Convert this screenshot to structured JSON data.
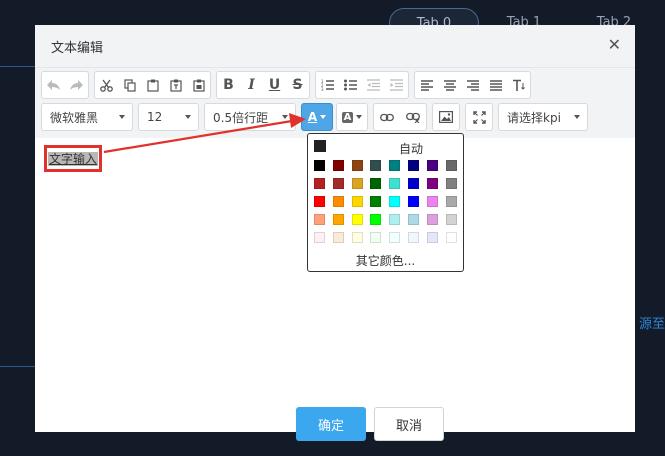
{
  "background": {
    "tabs": [
      "Tab 0",
      "Tab 1",
      "Tab 2"
    ],
    "side_text": "源至"
  },
  "dialog": {
    "title": "文本编辑",
    "close_glyph": "✕"
  },
  "toolbar": {
    "font_family": "微软雅黑",
    "font_size": "12",
    "line_height": "0.5倍行距",
    "kpi_placeholder": "请选择kpi",
    "icons_row1": [
      "undo-icon",
      "redo-icon",
      "cut-icon",
      "copy-icon",
      "paste-icon",
      "paste-text-icon",
      "paste-word-icon",
      "bold-icon",
      "italic-icon",
      "underline-icon",
      "strikethrough-icon",
      "ordered-list-icon",
      "unordered-list-icon",
      "outdent-icon",
      "indent-icon",
      "align-left-icon",
      "align-center-icon",
      "align-right-icon",
      "align-justify-icon",
      "clear-format-icon"
    ],
    "icons_row2": [
      "font-color-icon",
      "background-color-icon",
      "link-icon",
      "unlink-icon",
      "image-icon",
      "fullscreen-icon"
    ],
    "font_color_letter": "A",
    "bg_color_letter": "A"
  },
  "editor": {
    "content": "文字输入"
  },
  "color_picker": {
    "auto_label": "自动",
    "more_label": "其它颜色...",
    "rows": [
      [
        "#000000",
        "#800000",
        "#8b4513",
        "#2f4f4f",
        "#008080",
        "#000080",
        "#4b0082",
        "#696969"
      ],
      [
        "#b22222",
        "#a52a2a",
        "#daa520",
        "#006400",
        "#40e0d0",
        "#0000cd",
        "#800080",
        "#808080"
      ],
      [
        "#ff0000",
        "#ff8c00",
        "#ffd700",
        "#008000",
        "#00ffff",
        "#0000ff",
        "#ee82ee",
        "#a9a9a9"
      ],
      [
        "#ffa07a",
        "#ffa500",
        "#ffff00",
        "#00ff00",
        "#afeeee",
        "#add8e6",
        "#dda0dd",
        "#d3d3d3"
      ],
      [
        "#fff0f5",
        "#faebd7",
        "#ffffe0",
        "#f0fff0",
        "#f0ffff",
        "#f0f8ff",
        "#e6e6fa",
        "#ffffff"
      ]
    ]
  },
  "footer": {
    "ok_label": "确定",
    "cancel_label": "取消"
  },
  "colors": {
    "accent": "#3aa7ef",
    "highlight_border": "#e0322b",
    "arrow": "#e0322b"
  }
}
